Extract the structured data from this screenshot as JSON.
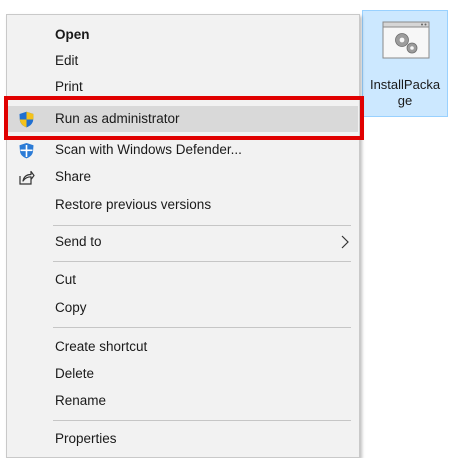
{
  "context_menu": {
    "items": [
      {
        "label": "Open"
      },
      {
        "label": "Edit"
      },
      {
        "label": "Print"
      },
      {
        "label": "Run as administrator"
      },
      {
        "label": "Scan with Windows Defender..."
      },
      {
        "label": "Share"
      },
      {
        "label": "Restore previous versions"
      },
      {
        "label": "Send to"
      },
      {
        "label": "Cut"
      },
      {
        "label": "Copy"
      },
      {
        "label": "Create shortcut"
      },
      {
        "label": "Delete"
      },
      {
        "label": "Rename"
      },
      {
        "label": "Properties"
      }
    ]
  },
  "desktop_icon": {
    "caption": "InstallPackage"
  },
  "colors": {
    "highlight_border": "#e00000",
    "icon_selection": "#cce8ff",
    "menu_background": "#f2f2f2",
    "hover_background": "#d9d9d9"
  }
}
